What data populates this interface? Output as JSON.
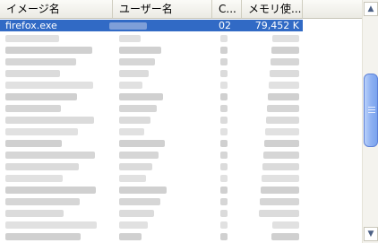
{
  "columns": [
    {
      "label": "イメージ名"
    },
    {
      "label": "ユーザー名"
    },
    {
      "label": "C..."
    },
    {
      "label": "メモリ使..."
    }
  ],
  "selected_row": {
    "image_name": "firefox.exe",
    "cpu": "02",
    "memory": "79,452 K"
  },
  "blurred_row_count": 18,
  "scrollbar": {
    "up_icon": "chevron-up-icon",
    "down_icon": "chevron-down-icon"
  },
  "colors": {
    "selection": "#316ac5",
    "blur": "#c8c8c8"
  }
}
